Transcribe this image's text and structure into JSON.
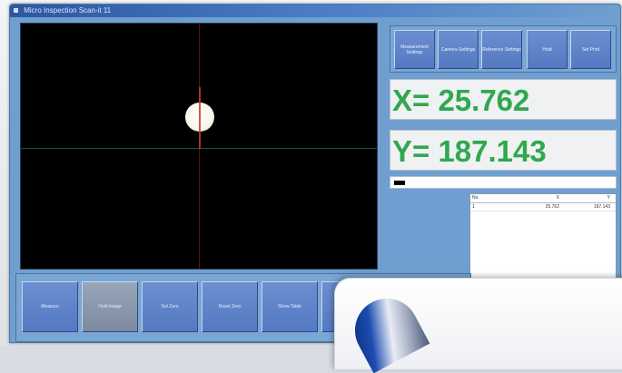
{
  "window": {
    "title": "Micro Inspection Scan-it 11"
  },
  "toolbar": {
    "buttons": [
      {
        "label": "Measurement Settings"
      },
      {
        "label": "Camera Settings"
      },
      {
        "label": "Reference Settings"
      },
      {
        "label": "Hold"
      },
      {
        "label": "Set Print"
      }
    ]
  },
  "readouts": {
    "x": "X= 25.762",
    "y": "Y= 187.143"
  },
  "results_table": {
    "headers": [
      "No.",
      "X",
      "Y"
    ],
    "rows": [
      [
        "1",
        "25.762",
        "187.143"
      ]
    ]
  },
  "bottom_buttons": [
    {
      "label": "Measure"
    },
    {
      "label": "Hold Image"
    },
    {
      "label": "Set Zero"
    },
    {
      "label": "Reset Zero"
    },
    {
      "label": "Show Table"
    },
    {
      "label": ""
    },
    {
      "label": ""
    }
  ],
  "colors": {
    "readout_text": "#2fa84f",
    "window_bg": "#6f9fd0",
    "button_blue": "#5f85c8"
  }
}
